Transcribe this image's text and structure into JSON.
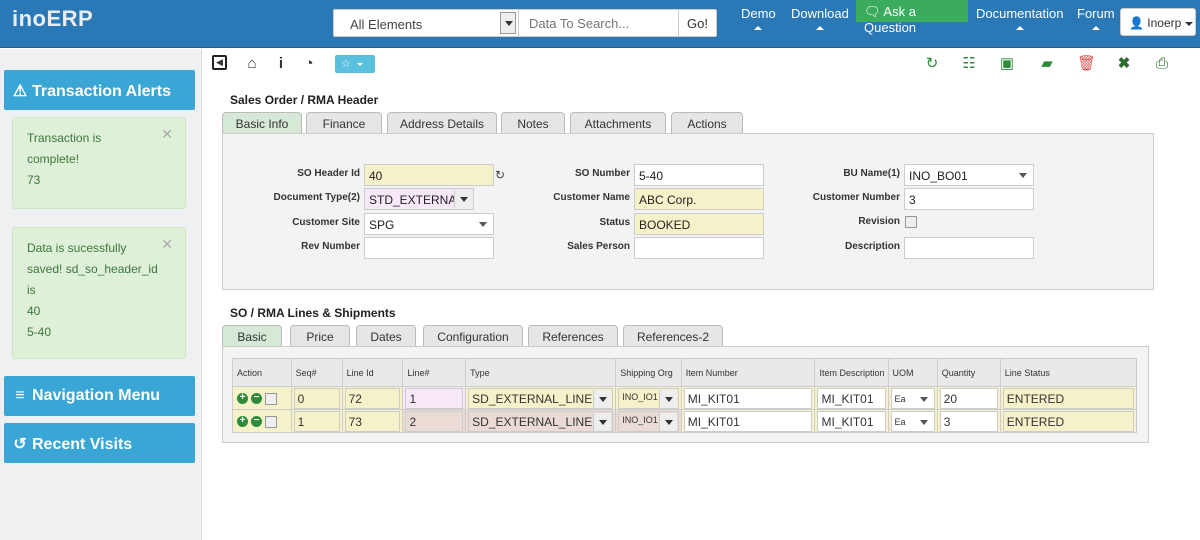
{
  "app": {
    "logo": "inoERP"
  },
  "search": {
    "scope": "All Elements",
    "placeholder": "Data To Search...",
    "go_label": "Go!"
  },
  "nav": {
    "demo": "Demo",
    "download": "Download",
    "ask": "Ask a Question",
    "documentation": "Documentation",
    "forum": "Forum",
    "user": "Inoerp"
  },
  "sidebar": {
    "transaction_alerts": "Transaction Alerts",
    "alert1": {
      "line1": "Transaction is",
      "line2": "complete!",
      "line3": "73"
    },
    "alert2": {
      "line1": "Data is sucessfully",
      "line2": "saved! sd_so_header_id",
      "line3": "is",
      "line4": "40",
      "line5": "5-40"
    },
    "navigation_menu": "Navigation Menu",
    "recent_visits": "Recent Visits"
  },
  "toolbar": {
    "icons": [
      "back-icon",
      "home-icon",
      "info-icon",
      "dashboard-icon",
      "favorite-icon",
      "refresh-icon",
      "document-icon",
      "save-icon",
      "clear-icon",
      "delete-icon",
      "close-icon",
      "print-icon"
    ],
    "colors": {
      "green": "#2e8b3a",
      "red": "#e05050",
      "blue": "#5bc0de"
    }
  },
  "header": {
    "title": "Sales Order / RMA Header",
    "tabs": [
      "Basic Info",
      "Finance",
      "Address Details",
      "Notes",
      "Attachments",
      "Actions"
    ],
    "fields": {
      "so_header_id_label": "SO Header Id",
      "so_header_id": "40",
      "document_type_label": "Document Type(2)",
      "document_type": "STD_EXTERNAL",
      "customer_site_label": "Customer Site",
      "customer_site": "SPG",
      "rev_number_label": "Rev Number",
      "rev_number": "",
      "so_number_label": "SO Number",
      "so_number": "5-40",
      "customer_name_label": "Customer Name",
      "customer_name": "ABC Corp.",
      "status_label": "Status",
      "status": "BOOKED",
      "sales_person_label": "Sales Person",
      "sales_person": "",
      "bu_name_label": "BU Name(1)",
      "bu_name": "INO_BO01",
      "customer_number_label": "Customer Number",
      "customer_number": "3",
      "revision_label": "Revision",
      "description_label": "Description",
      "description": ""
    }
  },
  "lines": {
    "title": "SO / RMA Lines & Shipments",
    "tabs": [
      "Basic",
      "Price",
      "Dates",
      "Configuration",
      "References",
      "References-2"
    ],
    "columns": [
      "Action",
      "Seq#",
      "Line Id",
      "Line#",
      "Type",
      "Shipping Org",
      "Item Number",
      "Item Description",
      "UOM",
      "Quantity",
      "Line Status"
    ],
    "rows": [
      {
        "seq": "0",
        "line_id": "72",
        "line_no": "1",
        "type": "SD_EXTERNAL_LINE",
        "ship_org": "INO_IO1",
        "item_number": "MI_KIT01",
        "item_description": "MI_KIT01",
        "uom": "Ea",
        "quantity": "20",
        "status": "ENTERED"
      },
      {
        "seq": "1",
        "line_id": "73",
        "line_no": "2",
        "type": "SD_EXTERNAL_LINE",
        "ship_org": "INO_IO1",
        "item_number": "MI_KIT01",
        "item_description": "MI_KIT01",
        "uom": "Ea",
        "quantity": "3",
        "status": "ENTERED"
      }
    ]
  }
}
